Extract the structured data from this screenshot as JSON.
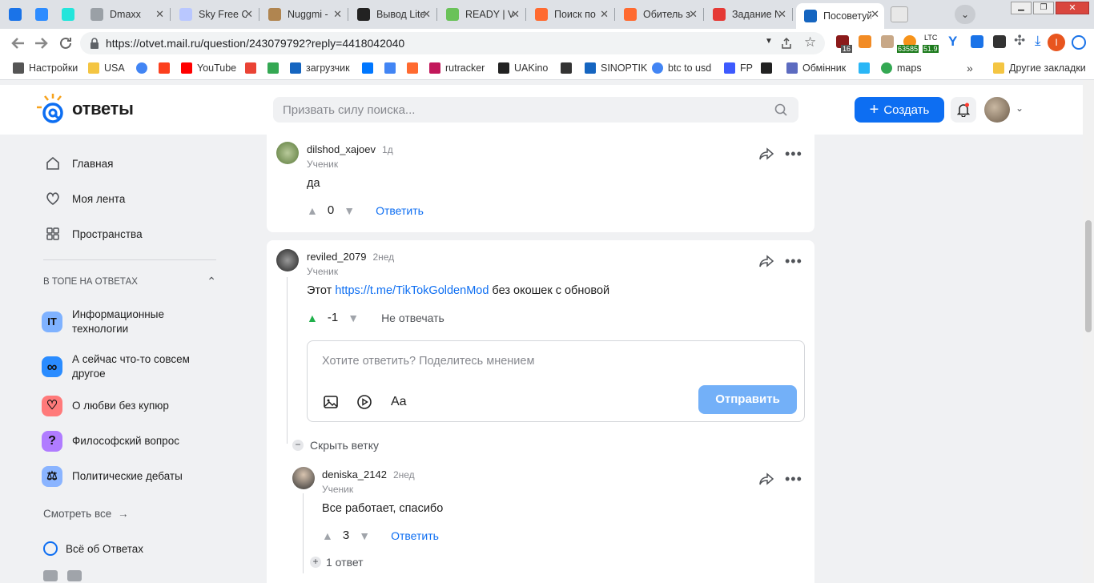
{
  "browser": {
    "tabs": [
      {
        "title": "",
        "icon": "vpn-v-icon",
        "color": "#1a73e8"
      },
      {
        "title": "",
        "icon": "seo-icon",
        "color": "#2d8cff"
      },
      {
        "title": "",
        "icon": "olx-icon",
        "color": "#23e5db"
      },
      {
        "title": "Dmaxx",
        "icon": "globe-icon",
        "color": "#9aa0a6"
      },
      {
        "title": "Sky Free C",
        "icon": "cloud-icon",
        "color": "#b9c7ff"
      },
      {
        "title": "Nuggmi -",
        "icon": "box-icon",
        "color": "#b08550"
      },
      {
        "title": "Вывод Lite",
        "icon": "bc-icon",
        "color": "#222"
      },
      {
        "title": "READY | V",
        "icon": "v-check-icon",
        "color": "#6ac259"
      },
      {
        "title": "Поиск по",
        "icon": "f-icon",
        "color": "#ff6a30"
      },
      {
        "title": "Обитель з",
        "icon": "f-icon",
        "color": "#ff6a30"
      },
      {
        "title": "Задание N",
        "icon": "sp-icon",
        "color": "#e53935"
      },
      {
        "title": "Посоветуй",
        "icon": "question-icon",
        "color": "#1565c0"
      }
    ],
    "url": "https://otvet.mail.ru/question/243079792?reply=4418042040",
    "ext_badges": {
      "ext1": "16",
      "btc": "63585",
      "ltc_label": "LTC",
      "ltc": "51.9"
    },
    "profile_initial": "I",
    "bookmarks": [
      {
        "label": "Настройки",
        "icon": "gear-icon",
        "color": "#555"
      },
      {
        "label": "USA",
        "icon": "folder-icon",
        "color": "#f4c542"
      },
      {
        "label": "",
        "icon": "google-icon",
        "color": "#4285f4"
      },
      {
        "label": "",
        "icon": "yandex-icon",
        "color": "#fc3f1d"
      },
      {
        "label": "YouTube",
        "icon": "youtube-icon",
        "color": "#ff0000"
      },
      {
        "label": "",
        "icon": "gmail-icon",
        "color": "#ea4335"
      },
      {
        "label": "",
        "icon": "drive-icon",
        "color": "#34a853"
      },
      {
        "label": "загрузчик",
        "icon": "infinity-icon",
        "color": "#1565c0"
      },
      {
        "label": "",
        "icon": "vk-icon",
        "color": "#0077ff"
      },
      {
        "label": "",
        "icon": "translate-icon",
        "color": "#4285f4"
      },
      {
        "label": "",
        "icon": "f-icon",
        "color": "#ff6a30"
      },
      {
        "label": "rutracker",
        "icon": "rutracker-icon",
        "color": "#c2185b"
      },
      {
        "label": "UAKino",
        "icon": "uakino-icon",
        "color": "#222"
      },
      {
        "label": "",
        "icon": "horse-icon",
        "color": "#333"
      },
      {
        "label": "SINOPTIK",
        "icon": "thermometer-icon",
        "color": "#1565c0"
      },
      {
        "label": "btc to usd",
        "icon": "google-icon",
        "color": "#4285f4"
      },
      {
        "label": "FP",
        "icon": "fp-icon",
        "color": "#3d5afe"
      },
      {
        "label": "",
        "icon": "bc-icon",
        "color": "#222"
      },
      {
        "label": "Обмінник",
        "icon": "diamond-icon",
        "color": "#5c6bc0"
      },
      {
        "label": "",
        "icon": "star-icon",
        "color": "#29b6f6"
      },
      {
        "label": "maps",
        "icon": "maps-icon",
        "color": "#34a853"
      }
    ],
    "overflow": "»",
    "other_bookmarks": "Другие закладки"
  },
  "site": {
    "logo_text": "ответы",
    "search_placeholder": "Призвать силу поиска...",
    "create_label": "Создать"
  },
  "sidebar": {
    "nav": [
      {
        "label": "Главная",
        "icon": "home-icon"
      },
      {
        "label": "Моя лента",
        "icon": "feed-icon"
      },
      {
        "label": "Пространства",
        "icon": "spaces-icon"
      }
    ],
    "section_title": "В ТОПЕ НА ОТВЕТАХ",
    "topics": [
      {
        "line1": "Информационные",
        "line2": "технологии",
        "icon": "it-icon",
        "badge": "IT",
        "color": "#7fb2ff"
      },
      {
        "line1": "А сейчас что-то совсем",
        "line2": "другое",
        "icon": "infinity-icon",
        "badge": "∞",
        "color": "#2a8cff"
      },
      {
        "line1": "О любви без купюр",
        "line2": "",
        "icon": "heart-icon",
        "badge": "♡",
        "color": "#ff7a7a"
      },
      {
        "line1": "Философский вопрос",
        "line2": "",
        "icon": "question-icon",
        "badge": "?",
        "color": "#b07cff"
      },
      {
        "line1": "Политические дебаты",
        "line2": "",
        "icon": "debate-icon",
        "badge": "⚖",
        "color": "#8ab4ff"
      }
    ],
    "see_all": "Смотреть все",
    "about": "Всё об Ответах"
  },
  "answers": [
    {
      "user": "dilshod_xajoev",
      "ago": "1д",
      "role": "Ученик",
      "text": "да",
      "votes": "0",
      "action": "Ответить"
    },
    {
      "user": "reviled_2079",
      "ago": "2нед",
      "role": "Ученик",
      "text_before": "Этот ",
      "link": "https://t.me/TikTokGoldenMod",
      "text_after": " без окошек с обновой",
      "votes": "-1",
      "action": "Не отвечать",
      "reply_placeholder": "Хотите ответить? Поделитесь мнением",
      "send_label": "Отправить",
      "font_label": "Aa",
      "hide_branch": "Скрыть ветку"
    },
    {
      "user": "deniska_2142",
      "ago": "2нед",
      "role": "Ученик",
      "text": "Все работает, спасибо",
      "votes": "3",
      "action": "Ответить",
      "more_replies": "1 ответ"
    }
  ]
}
